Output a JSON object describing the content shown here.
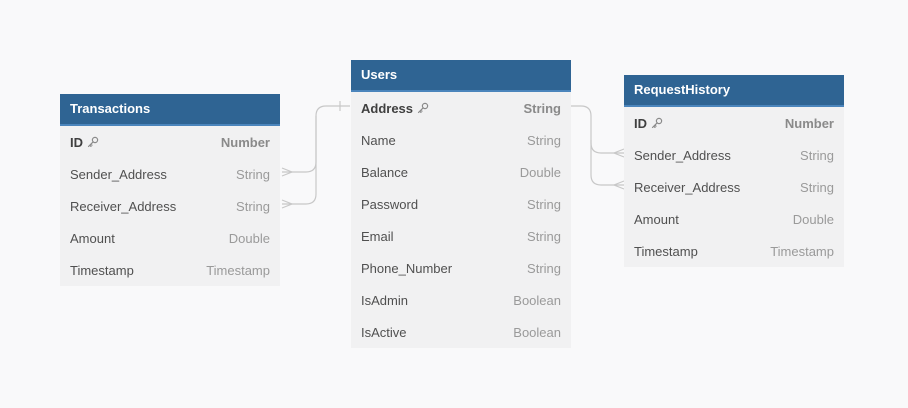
{
  "colors": {
    "header": "#2f6493",
    "header_accent": "#4b85bc",
    "table_body": "#f1f1f2",
    "background": "#f9f9fa",
    "connector": "#c8c8c8"
  },
  "tables": {
    "transactions": {
      "title": "Transactions",
      "fields": [
        {
          "name": "ID",
          "type": "Number",
          "primary_key": true
        },
        {
          "name": "Sender_Address",
          "type": "String"
        },
        {
          "name": "Receiver_Address",
          "type": "String"
        },
        {
          "name": "Amount",
          "type": "Double"
        },
        {
          "name": "Timestamp",
          "type": "Timestamp"
        }
      ]
    },
    "users": {
      "title": "Users",
      "fields": [
        {
          "name": "Address",
          "type": "String",
          "primary_key": true
        },
        {
          "name": "Name",
          "type": "String"
        },
        {
          "name": "Balance",
          "type": "Double"
        },
        {
          "name": "Password",
          "type": "String"
        },
        {
          "name": "Email",
          "type": "String"
        },
        {
          "name": "Phone_Number",
          "type": "String"
        },
        {
          "name": "IsAdmin",
          "type": "Boolean"
        },
        {
          "name": "IsActive",
          "type": "Boolean"
        }
      ]
    },
    "requesthistory": {
      "title": "RequestHistory",
      "fields": [
        {
          "name": "ID",
          "type": "Number",
          "primary_key": true
        },
        {
          "name": "Sender_Address",
          "type": "String"
        },
        {
          "name": "Receiver_Address",
          "type": "String"
        },
        {
          "name": "Amount",
          "type": "Double"
        },
        {
          "name": "Timestamp",
          "type": "Timestamp"
        }
      ]
    }
  },
  "relationships": [
    {
      "from": "transactions.Sender_Address",
      "to": "users.Address",
      "cardinality": "many-to-one"
    },
    {
      "from": "transactions.Receiver_Address",
      "to": "users.Address",
      "cardinality": "many-to-one"
    },
    {
      "from": "requesthistory.Sender_Address",
      "to": "users.Address",
      "cardinality": "many-to-one"
    },
    {
      "from": "requesthistory.Receiver_Address",
      "to": "users.Address",
      "cardinality": "many-to-one"
    }
  ]
}
